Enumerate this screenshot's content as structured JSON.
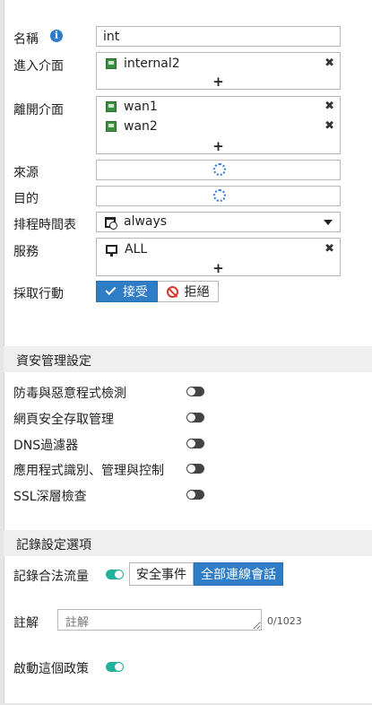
{
  "form": {
    "name_label": "名稱",
    "name_value": "int",
    "incoming_label": "進入介面",
    "incoming_items": [
      "internal2"
    ],
    "outgoing_label": "離開介面",
    "outgoing_items": [
      "wan1",
      "wan2"
    ],
    "source_label": "來源",
    "destination_label": "目的",
    "schedule_label": "排程時間表",
    "schedule_value": "always",
    "service_label": "服務",
    "service_items": [
      "ALL"
    ],
    "action_label": "採取行動",
    "action_accept": "接受",
    "action_deny": "拒絕",
    "add_symbol": "+",
    "remove_symbol": "✖",
    "info_symbol": "i"
  },
  "security": {
    "header": "資安管理設定",
    "items": [
      {
        "label": "防毒與惡意程式檢測",
        "enabled": false
      },
      {
        "label": "網頁安全存取管理",
        "enabled": false
      },
      {
        "label": "DNS過濾器",
        "enabled": false
      },
      {
        "label": "應用程式識別、管理與控制",
        "enabled": false
      },
      {
        "label": "SSL深層檢查",
        "enabled": false
      }
    ]
  },
  "logging": {
    "header": "記錄設定選項",
    "log_traffic_label": "記錄合法流量",
    "log_traffic_enabled": true,
    "option_security_events": "安全事件",
    "option_all_sessions": "全部連線會話",
    "selected_option": "全部連線會話",
    "comment_label": "註解",
    "comment_placeholder": "註解",
    "comment_count": "0/1023",
    "enable_policy_label": "啟動這個政策",
    "enable_policy_enabled": true
  },
  "colors": {
    "accent": "#2f7dc6",
    "toggle_on": "#20b39b",
    "toggle_off": "#444444",
    "deny": "#d9372c"
  }
}
